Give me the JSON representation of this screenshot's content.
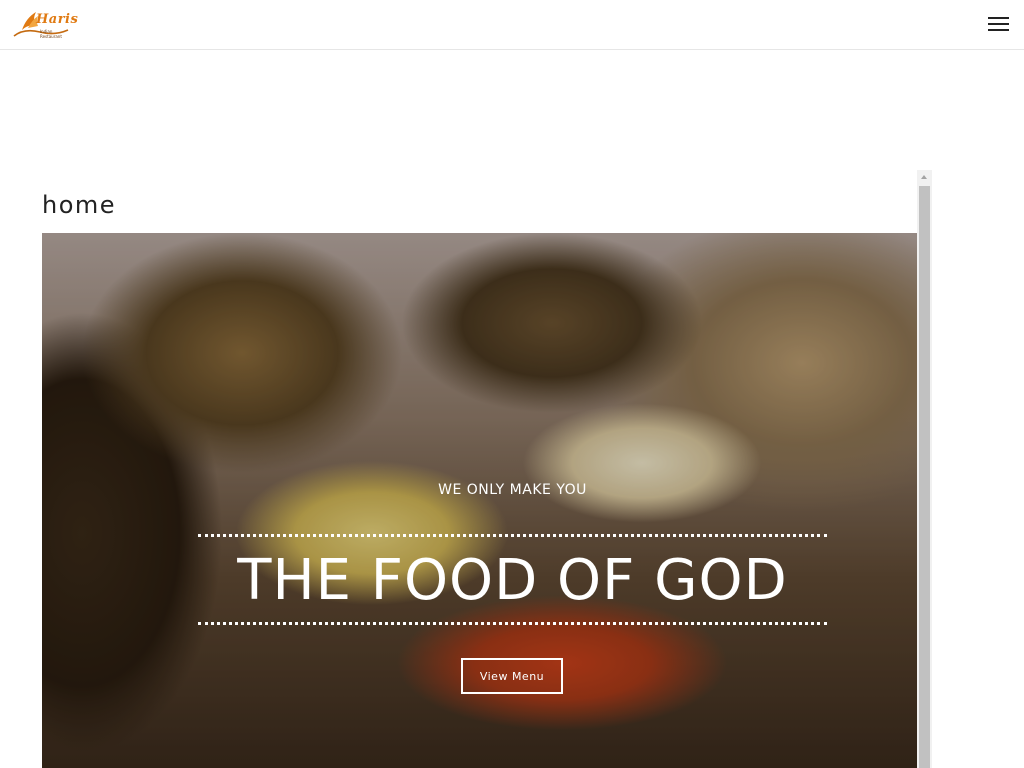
{
  "header": {
    "logo": {
      "name": "Haris",
      "tagline": "Indian Restaurant",
      "icon": "flame-swirl-icon"
    },
    "menu_icon": "hamburger-menu-icon"
  },
  "page": {
    "title": "home"
  },
  "hero": {
    "kicker": "WE ONLY MAKE YOU",
    "title": "THE FOOD OF GOD",
    "button_label": "View Menu"
  },
  "colors": {
    "accent": "#e07a12",
    "text": "#222222",
    "hero_text": "#ffffff"
  }
}
